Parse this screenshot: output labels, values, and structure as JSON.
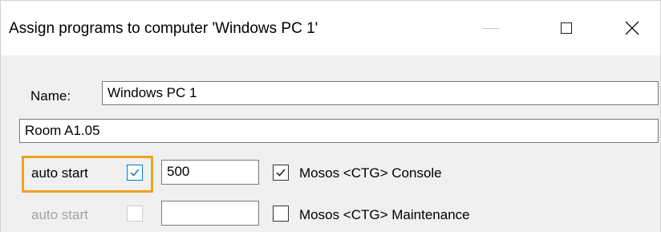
{
  "window": {
    "title": "Assign programs to computer 'Windows PC 1'",
    "accent_color": "#0078d7",
    "highlight_color": "#f0a21e"
  },
  "form": {
    "name_label": "Name:",
    "name_value": "Windows PC 1",
    "room_value": "Room A1.05"
  },
  "programs": [
    {
      "auto_start_label": "auto start",
      "auto_start_checked": true,
      "auto_start_enabled": true,
      "value": "500",
      "program_checked": true,
      "program_label": "Mosos <CTG> Console"
    },
    {
      "auto_start_label": "auto start",
      "auto_start_checked": false,
      "auto_start_enabled": false,
      "value": "",
      "program_checked": false,
      "program_label": "Mosos <CTG> Maintenance"
    }
  ]
}
